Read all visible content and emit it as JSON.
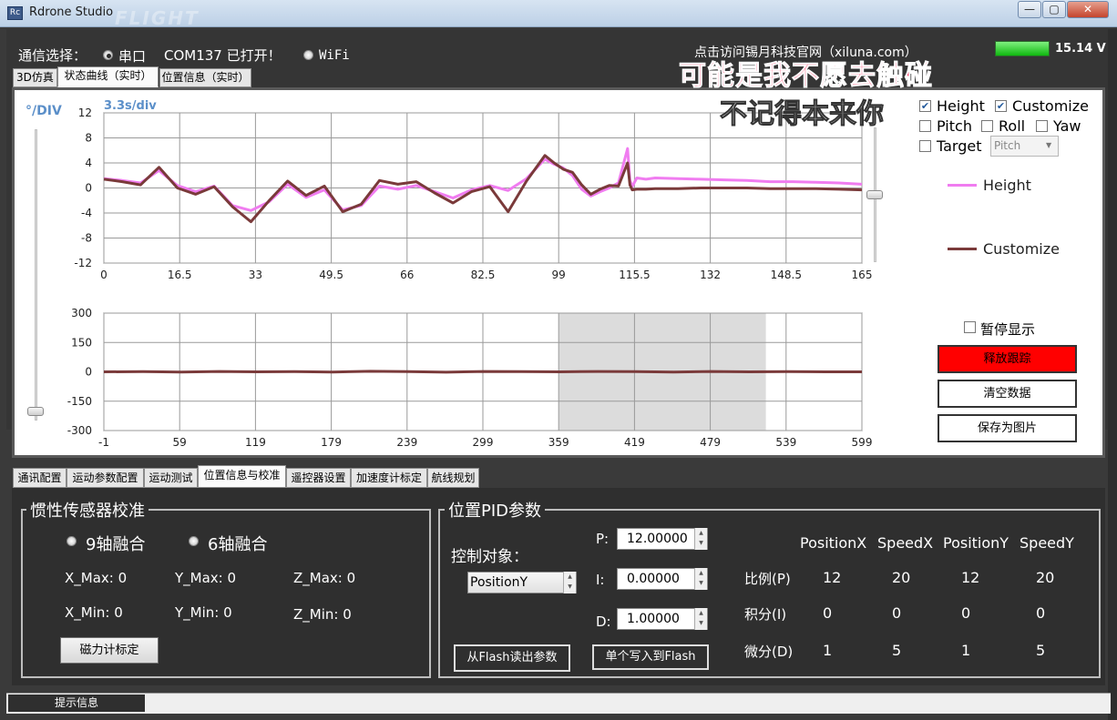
{
  "window": {
    "title": "Rdrone Studio",
    "watermark": "FLIGHT",
    "icon_text": "Rc",
    "controls": {
      "minimize": "—",
      "maximize": "▢",
      "close": "✕"
    }
  },
  "comm": {
    "label": "通信选择：",
    "serial_label": "串口",
    "serial_selected": true,
    "status": "COM137 已打开！",
    "wifi_label": "WiFi",
    "website": "点击访问锡月科技官网（xiluna.com）"
  },
  "battery": {
    "voltage": "15.14 V",
    "level": 1.0,
    "color": "#19c419"
  },
  "overlay_lyrics": [
    "可能是我不愿去触碰",
    "不记得本来你"
  ],
  "top_tabs": [
    {
      "label": "3D仿真",
      "active": false
    },
    {
      "label": "状态曲线（实时）",
      "active": true
    },
    {
      "label": "位置信息（实时）",
      "active": false
    }
  ],
  "chart_data": [
    {
      "type": "line",
      "scale_label": "°/DIV",
      "time_label": "3.3s/div",
      "ylim": [
        -12,
        12
      ],
      "yticks": [
        "12",
        "8",
        "4",
        "0",
        "-4",
        "-8",
        "-12"
      ],
      "xlim": [
        0,
        165
      ],
      "xticks": [
        "0",
        "16.5",
        "33",
        "49.5",
        "66",
        "82.5",
        "99",
        "115.5",
        "132",
        "148.5",
        "165"
      ],
      "series": [
        {
          "name": "Height",
          "color": "#f07cf0",
          "x": [
            0,
            4,
            8,
            12,
            16,
            20,
            24,
            28,
            32,
            36,
            40,
            44,
            48,
            52,
            56,
            60,
            64,
            68,
            72,
            76,
            80,
            84,
            88,
            92,
            96,
            98,
            100,
            102,
            104,
            106,
            108,
            110,
            112,
            114,
            114.5,
            115,
            116,
            118,
            120,
            125,
            130,
            135,
            140,
            145,
            150,
            155,
            160,
            165
          ],
          "y": [
            1.5,
            1.2,
            0.8,
            2.8,
            0.4,
            -0.6,
            0.3,
            -2.8,
            -3.6,
            -2.2,
            0.6,
            -1.5,
            -0.3,
            -3.5,
            -2.8,
            0.3,
            -0.2,
            0.4,
            -0.6,
            -1.6,
            -0.3,
            0.4,
            -0.4,
            1.5,
            4.6,
            3.8,
            3.2,
            2.0,
            -0.2,
            -1.3,
            -0.6,
            0.0,
            0.8,
            6.3,
            1.2,
            0.2,
            1.6,
            1.4,
            1.6,
            1.5,
            1.4,
            1.3,
            1.2,
            1.0,
            1.0,
            0.9,
            0.8,
            0.6
          ]
        },
        {
          "name": "Customize",
          "color": "#7a3a3a",
          "x": [
            0,
            4,
            8,
            12,
            16,
            20,
            24,
            28,
            32,
            36,
            40,
            44,
            48,
            52,
            56,
            60,
            64,
            68,
            72,
            76,
            80,
            84,
            88,
            92,
            96,
            98,
            100,
            102,
            104,
            106,
            108,
            110,
            112,
            114,
            114.5,
            115,
            116,
            118,
            120,
            125,
            130,
            135,
            140,
            145,
            150,
            155,
            160,
            165
          ],
          "y": [
            1.4,
            1.0,
            0.5,
            3.3,
            0.0,
            -1.0,
            0.2,
            -3.0,
            -5.4,
            -2.0,
            1.1,
            -1.2,
            0.3,
            -3.8,
            -2.6,
            1.2,
            0.6,
            1.0,
            -0.8,
            -2.4,
            -0.6,
            0.2,
            -3.8,
            1.1,
            5.2,
            4.0,
            3.0,
            2.5,
            0.5,
            -1.0,
            -0.2,
            0.4,
            0.3,
            4.0,
            0.5,
            -0.3,
            -0.2,
            -0.2,
            -0.1,
            -0.1,
            0.0,
            0.0,
            0.0,
            -0.1,
            -0.1,
            -0.1,
            -0.2,
            -0.3
          ]
        }
      ]
    },
    {
      "type": "line",
      "ylim": [
        -300,
        300
      ],
      "yticks": [
        "300",
        "150",
        "0",
        "-150",
        "-300"
      ],
      "xlim": [
        -1,
        599
      ],
      "xticks": [
        "-1",
        "59",
        "119",
        "179",
        "239",
        "299",
        "359",
        "419",
        "479",
        "539",
        "599"
      ],
      "highlight_range": [
        359,
        523
      ],
      "series": [
        {
          "name": "Customize",
          "color": "#7a3a3a",
          "x": [
            -1,
            30,
            60,
            90,
            120,
            150,
            180,
            210,
            240,
            270,
            300,
            330,
            360,
            390,
            420,
            450,
            480,
            510,
            540,
            570,
            599
          ],
          "y": [
            0,
            1,
            -1,
            2,
            0,
            1,
            -1,
            3,
            1,
            -2,
            2,
            1,
            0,
            2,
            1,
            -1,
            2,
            0,
            1,
            0,
            0
          ]
        }
      ]
    }
  ],
  "series_toggles": {
    "height": {
      "label": "Height",
      "checked": true
    },
    "customize": {
      "label": "Customize",
      "checked": true
    },
    "pitch": {
      "label": "Pitch",
      "checked": false
    },
    "roll": {
      "label": "Roll",
      "checked": false
    },
    "yaw": {
      "label": "Yaw",
      "checked": false
    },
    "target": {
      "label": "Target",
      "checked": false
    },
    "target_select": "Pitch"
  },
  "legend": [
    {
      "label": "Height",
      "color": "#f07cf0"
    },
    {
      "label": "Customize",
      "color": "#7a3a3a"
    }
  ],
  "chart_controls": {
    "pause_label": "暂停显示",
    "release_label": "释放跟踪",
    "clear_label": "清空数据",
    "save_label": "保存为图片"
  },
  "sliders": {
    "right_level": 0.5,
    "left_level": 0.03
  },
  "bottom_tabs": [
    {
      "label": "通讯配置",
      "active": false
    },
    {
      "label": "运动参数配置",
      "active": false
    },
    {
      "label": "运动测试",
      "active": false
    },
    {
      "label": "位置信息与校准",
      "active": true
    },
    {
      "label": "遥控器设置",
      "active": false
    },
    {
      "label": "加速度计标定",
      "active": false
    },
    {
      "label": "航线规划",
      "active": false
    }
  ],
  "imu": {
    "title": "惯性传感器校准",
    "opt9": "9轴融合",
    "opt6": "6轴融合",
    "x_max": "X_Max: 0",
    "y_max": "Y_Max: 0",
    "z_max": "Z_Max: 0",
    "x_min": "X_Min: 0",
    "y_min": "Y_Min: 0",
    "z_min": "Z_Min: 0",
    "mag_button": "磁力计标定"
  },
  "pid": {
    "title": "位置PID参数",
    "target_label": "控制对象：",
    "target_value": "PositionY",
    "p_label": "P:",
    "p_value": "12.00000",
    "i_label": "I:",
    "i_value": "0.00000",
    "d_label": "D:",
    "d_value": "1.00000",
    "read_button": "从Flash读出参数",
    "write_button": "单个写入到Flash",
    "table": {
      "columns": [
        "PositionX",
        "SpeedX",
        "PositionY",
        "SpeedY"
      ],
      "rows": [
        {
          "label": "比例(P)",
          "values": [
            "12",
            "20",
            "12",
            "20"
          ]
        },
        {
          "label": "积分(I)",
          "values": [
            "0",
            "0",
            "0",
            "0"
          ]
        },
        {
          "label": "微分(D)",
          "values": [
            "1",
            "5",
            "1",
            "5"
          ]
        }
      ]
    }
  },
  "statusbar": {
    "info_label": "提示信息"
  }
}
